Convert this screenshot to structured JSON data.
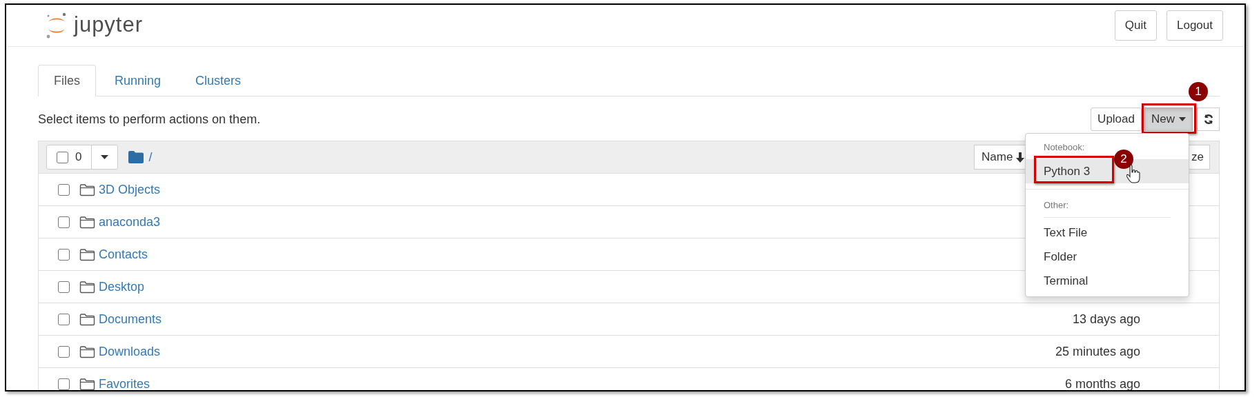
{
  "header": {
    "logo": "jupyter",
    "buttons": [
      "Quit",
      "Logout"
    ]
  },
  "tabs": [
    {
      "label": "Files",
      "selected": true
    },
    {
      "label": "Running",
      "selected": false
    },
    {
      "label": "Clusters",
      "selected": false
    }
  ],
  "hint": "Select items to perform actions on them.",
  "toolbar": {
    "upload": "Upload",
    "new": "New",
    "new_marker": "1"
  },
  "list_header": {
    "selected_count": "0",
    "checked": false,
    "path": "/",
    "sort_buttons": [
      "Name",
      "ze"
    ]
  },
  "rows": [
    {
      "name": "3D Objects",
      "checked": false
    },
    {
      "name": "anaconda3",
      "checked": false
    },
    {
      "name": "Contacts",
      "checked": false
    },
    {
      "name": "Desktop",
      "checked": false
    },
    {
      "name": "Documents",
      "checked": false,
      "modified": "13 days ago"
    },
    {
      "name": "Downloads",
      "checked": false,
      "modified": "25 minutes ago"
    },
    {
      "name": "Favorites",
      "checked": false,
      "modified": "6 months ago"
    }
  ],
  "new_menu": {
    "sections": [
      {
        "heading": "Notebook:",
        "items": [
          {
            "label": "Python 3",
            "selected": true,
            "marker": "2"
          }
        ]
      },
      {
        "heading": "Other:",
        "items": [
          {
            "label": "Text File",
            "selected": false
          },
          {
            "label": "Folder",
            "selected": false
          },
          {
            "label": "Terminal",
            "selected": false
          }
        ]
      }
    ]
  }
}
